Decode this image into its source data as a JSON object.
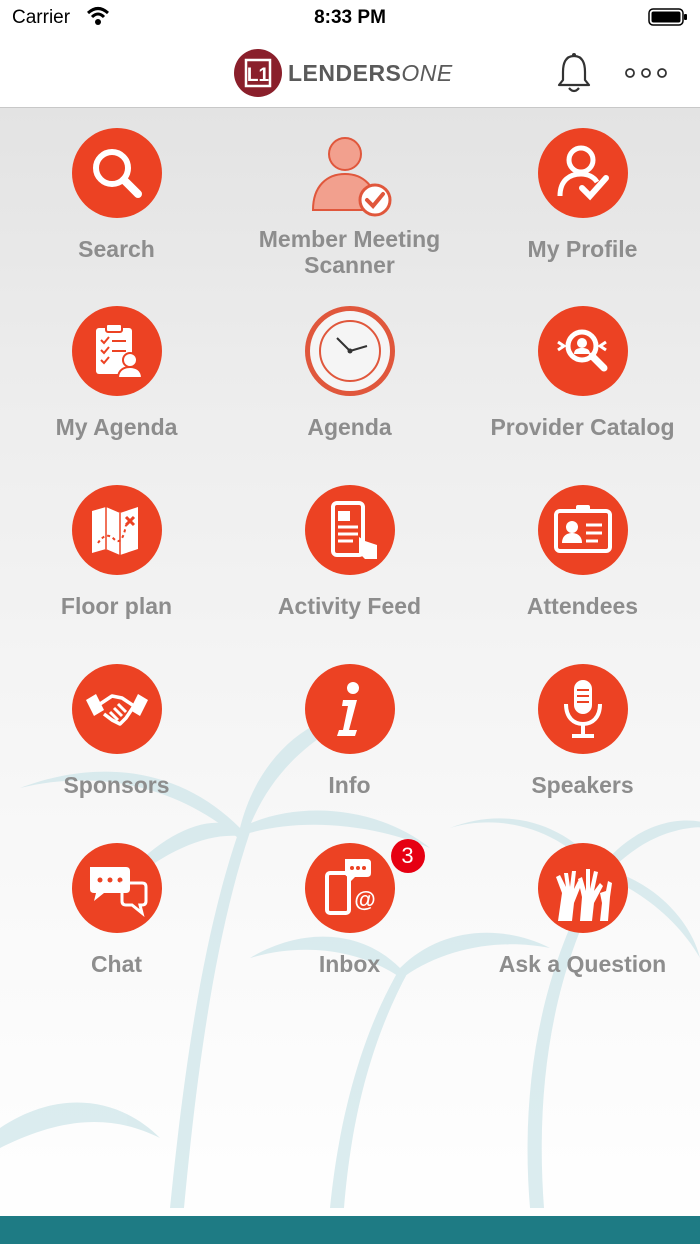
{
  "status_bar": {
    "carrier": "Carrier",
    "time": "8:33 PM"
  },
  "header": {
    "logo_text_main": "LENDERS",
    "logo_text_accent": "ONE",
    "logo_mark": "L1"
  },
  "colors": {
    "accent": "#ec4223",
    "logo": "#8a1f2b",
    "label": "#8d8d8d",
    "badge": "#e60012"
  },
  "tiles": [
    {
      "label": "Search",
      "icon": "magnifier-icon"
    },
    {
      "label": "Member Meeting Scanner",
      "icon": "person-check-icon"
    },
    {
      "label": "My Profile",
      "icon": "profile-icon"
    },
    {
      "label": "My Agenda",
      "icon": "clipboard-icon"
    },
    {
      "label": "Agenda",
      "icon": "clock-icon"
    },
    {
      "label": "Provider Catalog",
      "icon": "catalog-search-icon"
    },
    {
      "label": "Floor plan",
      "icon": "map-icon"
    },
    {
      "label": "Activity Feed",
      "icon": "phone-feed-icon"
    },
    {
      "label": "Attendees",
      "icon": "badge-id-icon"
    },
    {
      "label": "Sponsors",
      "icon": "handshake-icon"
    },
    {
      "label": "Info",
      "icon": "info-icon"
    },
    {
      "label": "Speakers",
      "icon": "microphone-icon"
    },
    {
      "label": "Chat",
      "icon": "chat-bubbles-icon"
    },
    {
      "label": "Inbox",
      "icon": "inbox-phone-icon",
      "badge": "3"
    },
    {
      "label": "Ask a Question",
      "icon": "raised-hands-icon"
    }
  ]
}
